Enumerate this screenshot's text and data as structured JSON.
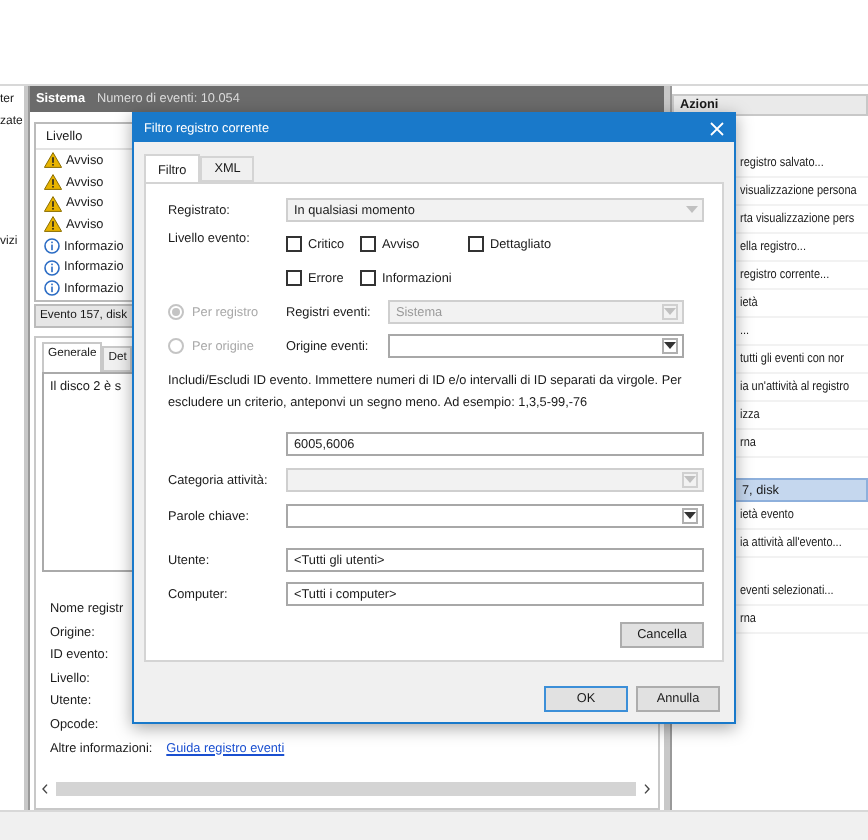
{
  "left_tree": {
    "groups": [
      [
        "ter",
        "zate"
      ],
      [
        "vizi"
      ]
    ]
  },
  "log_header": {
    "name": "Sistema",
    "count": "Numero di eventi: 10.054"
  },
  "event_list": {
    "columns": [
      "Livello"
    ],
    "rows": [
      {
        "kind": "warning",
        "level": "Avviso"
      },
      {
        "kind": "warning",
        "level": "Avviso"
      },
      {
        "kind": "warning",
        "level": "Avviso"
      },
      {
        "kind": "warning",
        "level": "Avviso"
      },
      {
        "kind": "info",
        "level": "Informazio"
      },
      {
        "kind": "info",
        "level": "Informazio"
      },
      {
        "kind": "info",
        "level": "Informazio"
      }
    ]
  },
  "event_detail": {
    "title": "Evento 157, disk",
    "tabs": [
      {
        "label": "Generale",
        "selected": true
      },
      {
        "label": "Det",
        "selected": false
      }
    ],
    "message": "Il disco 2 è s",
    "fields": [
      "Nome registr",
      "Origine:",
      "ID evento:",
      "Livello:",
      "Utente:",
      "Opcode:"
    ],
    "more_info": {
      "label": "Altre informazioni:",
      "link": "Guida registro eventi"
    }
  },
  "actions": {
    "title": "Azioni",
    "sections": [
      {
        "items": [
          "registro salvato...",
          "visualizzazione persona",
          "rta visualizzazione pers",
          "ella registro...",
          "registro corrente...",
          "ietà",
          "...",
          "tutti gli eventi con nor",
          "ia un'attività al registro",
          "izza",
          "rna"
        ]
      },
      {
        "header": "7, disk",
        "items": [
          "ietà evento",
          "ia attività all'evento..."
        ]
      },
      {
        "items": [
          "eventi selezionati...",
          "rna"
        ]
      }
    ]
  },
  "dialog": {
    "title": "Filtro registro corrente",
    "tabs": [
      {
        "label": "Filtro",
        "selected": true
      },
      {
        "label": "XML",
        "selected": false
      }
    ],
    "logged": {
      "label": "Registrato:",
      "value": "In qualsiasi momento"
    },
    "level": {
      "label": "Livello evento:",
      "options": [
        {
          "label": "Critico",
          "checked": false
        },
        {
          "label": "Avviso",
          "checked": false
        },
        {
          "label": "Dettagliato",
          "checked": false
        },
        {
          "label": "Errore",
          "checked": false
        },
        {
          "label": "Informazioni",
          "checked": false
        }
      ]
    },
    "sources": [
      {
        "label": "Per registro",
        "selected": true,
        "field_label": "Registri eventi:",
        "value": "Sistema",
        "disabled": true
      },
      {
        "label": "Per origine",
        "selected": false,
        "field_label": "Origine eventi:",
        "disabled": false
      }
    ],
    "id_help": "Includi/Escludi ID evento. Immettere numeri di ID e/o intervalli di ID separati da virgole. Per escludere un criterio, anteponvi un segno meno. Ad esempio: 1,3,5-99,-76",
    "event_ids": "6005,6006",
    "category": {
      "label": "Categoria attività:",
      "disabled": true
    },
    "keywords": {
      "label": "Parole chiave:",
      "disabled": false
    },
    "user": {
      "label": "Utente:",
      "value": "<Tutti gli utenti>"
    },
    "computer": {
      "label": "Computer:",
      "value": "<Tutti i computer>"
    },
    "clear_button": "Cancella",
    "ok_button": "OK",
    "cancel_button": "Annulla"
  }
}
